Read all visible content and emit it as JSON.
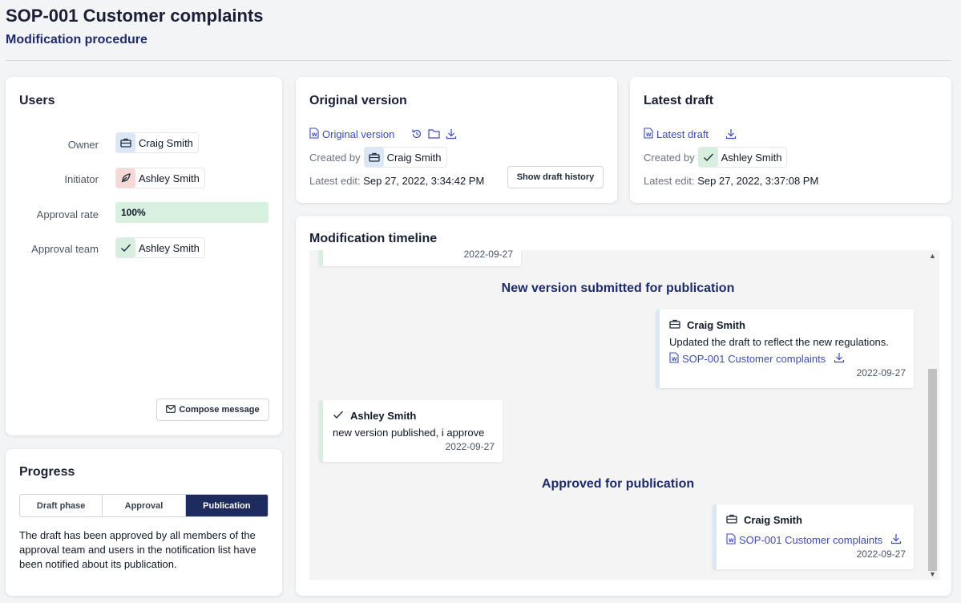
{
  "header": {
    "title": "SOP-001 Customer complaints",
    "subtitle": "Modification procedure"
  },
  "users": {
    "title": "Users",
    "owner_label": "Owner",
    "owner_name": "Craig Smith",
    "initiator_label": "Initiator",
    "initiator_name": "Ashley Smith",
    "approval_rate_label": "Approval rate",
    "approval_rate_value": "100%",
    "approval_rate": 1.0,
    "approval_team_label": "Approval team",
    "approval_team_name": "Ashley Smith",
    "compose_label": "Compose message"
  },
  "progress": {
    "title": "Progress",
    "steps": [
      "Draft phase",
      "Approval",
      "Publication"
    ],
    "active_step": "Publication",
    "description": "The draft has been approved by all members of the approval team and users in the notification list have been notified about its publication."
  },
  "original": {
    "title": "Original version",
    "link": "Original version",
    "created_by_label": "Created by",
    "created_by": "Craig Smith",
    "latest_edit_label": "Latest edit:",
    "latest_edit": "Sep 27, 2022, 3:34:42 PM",
    "history_button": "Show draft history"
  },
  "draft": {
    "title": "Latest draft",
    "link": "Latest draft",
    "created_by_label": "Created by",
    "created_by": "Ashley Smith",
    "latest_edit_label": "Latest edit:",
    "latest_edit": "Sep 27, 2022, 3:37:08 PM"
  },
  "timeline": {
    "title": "Modification timeline",
    "top_partial_date": "2022-09-27",
    "heading1": "New version submitted for publication",
    "entry1": {
      "name": "Craig Smith",
      "text": "Updated the draft to reflect the new regulations.",
      "link": "SOP-001 Customer complaints",
      "date": "2022-09-27"
    },
    "entry2": {
      "name": "Ashley Smith",
      "text": "new version published, i approve",
      "date": "2022-09-27"
    },
    "heading2": "Approved for publication",
    "entry3": {
      "name": "Craig Smith",
      "link": "SOP-001 Customer complaints",
      "date": "2022-09-27"
    }
  },
  "colors": {
    "accent": "#1d2b5e",
    "link": "#3b4bbd",
    "success_bg": "#d7f0df"
  },
  "icons": [
    "briefcase-icon",
    "feather-icon",
    "check-icon",
    "word-doc-icon",
    "history-icon",
    "folder-icon",
    "download-icon",
    "mail-icon"
  ]
}
